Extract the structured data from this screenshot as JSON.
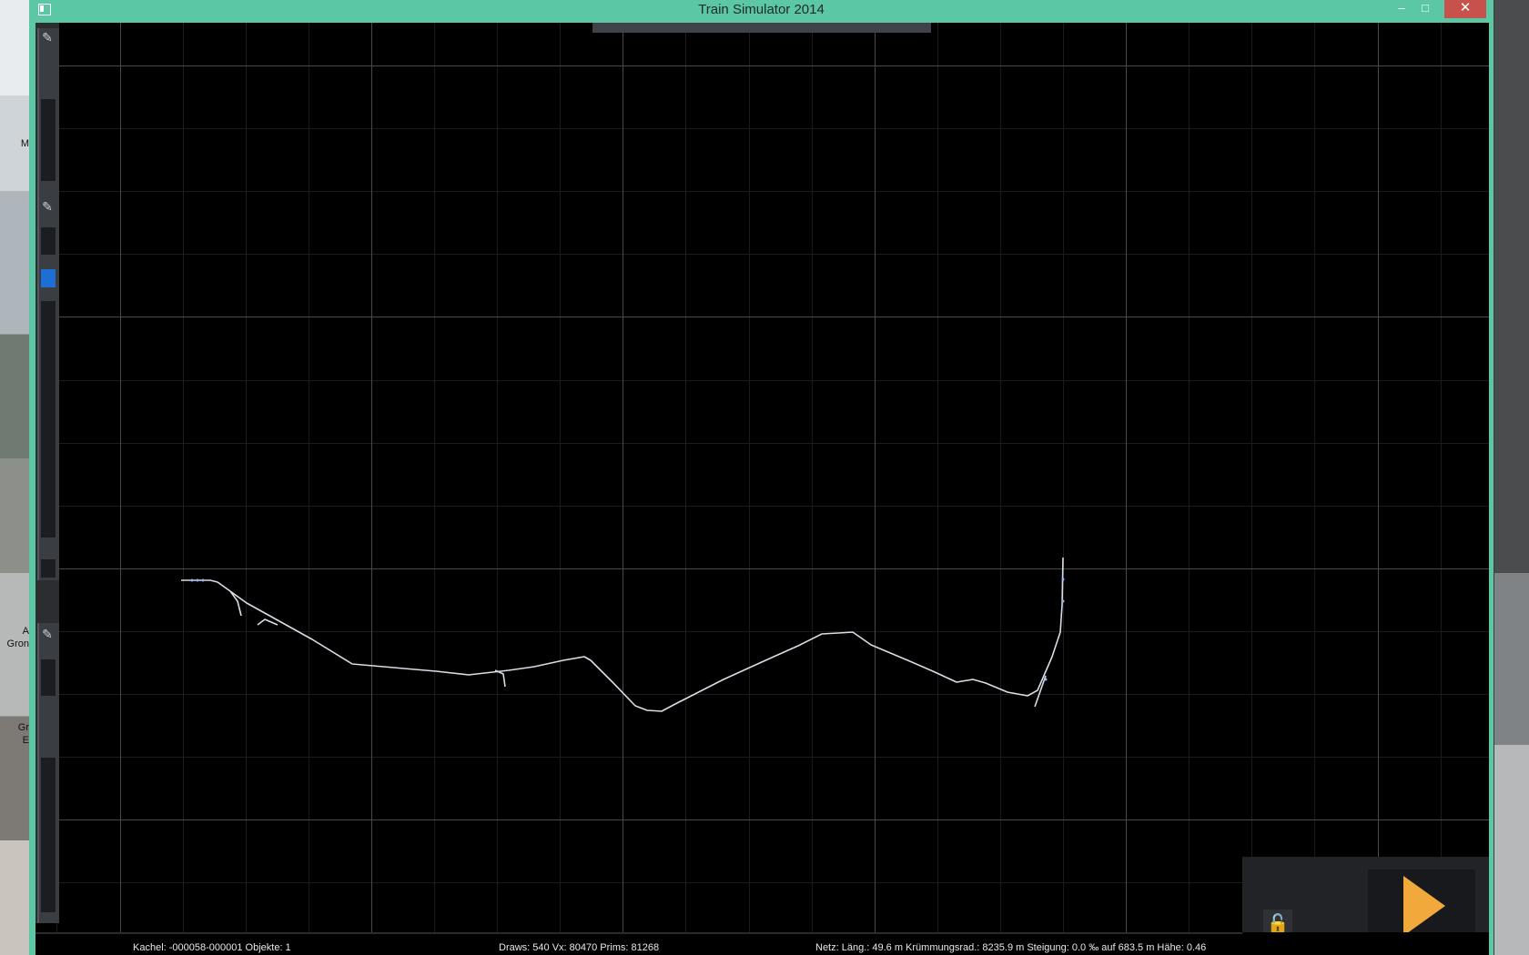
{
  "window": {
    "title": "Train Simulator 2014"
  },
  "titlebar": {
    "minimize": "–",
    "maximize": "□",
    "close": "✕"
  },
  "desktop": {
    "labels": [
      "M",
      "A",
      "Gron",
      "Gr",
      "E"
    ]
  },
  "editor": {
    "tools": [
      "pin-tool-icon",
      "pin-tool-icon",
      "pin-tool-icon"
    ],
    "tool_glyph": "✎",
    "lock_glyph": "🔓",
    "colors": {
      "background": "#000000",
      "grid_major": "#4a4a4a",
      "grid_minor": "#1c1c1c",
      "track": "#d8dde6",
      "track_marker": "#8fb6ff",
      "play": "#f0a93a",
      "window_accent": "#5cc7a4"
    }
  },
  "status": {
    "tile": "Kachel: -000058-000001  Objekte: 1",
    "draws": "Draws: 540 Vx: 80470 Prims: 81268",
    "net": "Netz:  Läng.:   49.6 m Krümmungsrad.: 8235.9 m Steigung:  0.0 ‰ auf 683.5 m Hähe:   0.46"
  }
}
